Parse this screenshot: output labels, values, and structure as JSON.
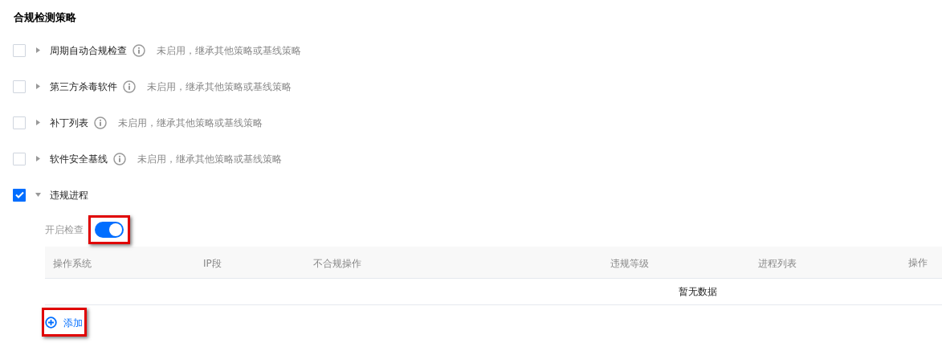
{
  "section_title": "合规检测策略",
  "policies": [
    {
      "label": "周期自动合规检查",
      "checked": false,
      "expanded": false,
      "status": "未启用，继承其他策略或基线策略"
    },
    {
      "label": "第三方杀毒软件",
      "checked": false,
      "expanded": false,
      "status": "未启用，继承其他策略或基线策略"
    },
    {
      "label": "补丁列表",
      "checked": false,
      "expanded": false,
      "status": "未启用，继承其他策略或基线策略"
    },
    {
      "label": "软件安全基线",
      "checked": false,
      "expanded": false,
      "status": "未启用，继承其他策略或基线策略"
    },
    {
      "label": "违规进程",
      "checked": true,
      "expanded": true
    }
  ],
  "check_toggle": {
    "label": "开启检查",
    "on": true,
    "highlighted": true
  },
  "table": {
    "columns": [
      "操作系统",
      "IP段",
      "不合规操作",
      "违规等级",
      "进程列表",
      "操作"
    ],
    "empty_text": "暂无数据"
  },
  "add_button": {
    "label": "添加",
    "highlighted": true
  }
}
